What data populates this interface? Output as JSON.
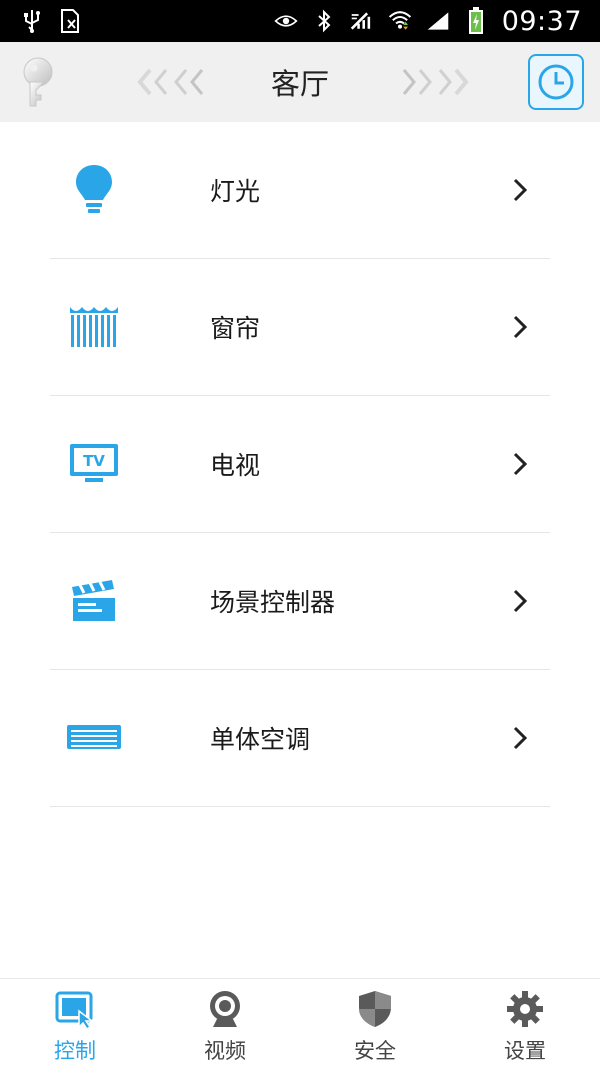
{
  "status_bar": {
    "time": "09:37"
  },
  "header": {
    "title": "客厅"
  },
  "devices": [
    {
      "label": "灯光",
      "icon": "lightbulb-icon"
    },
    {
      "label": "窗帘",
      "icon": "curtain-icon"
    },
    {
      "label": "电视",
      "icon": "tv-icon"
    },
    {
      "label": "场景控制器",
      "icon": "clapperboard-icon"
    },
    {
      "label": "单体空调",
      "icon": "air-conditioner-icon"
    }
  ],
  "tv_icon_text": "TV",
  "bottom_nav": [
    {
      "label": "控制",
      "icon": "control-icon",
      "active": true
    },
    {
      "label": "视频",
      "icon": "camera-icon",
      "active": false
    },
    {
      "label": "安全",
      "icon": "shield-icon",
      "active": false
    },
    {
      "label": "设置",
      "icon": "gear-icon",
      "active": false
    }
  ],
  "colors": {
    "accent": "#2aa6e8",
    "status_bar_bg": "#000000",
    "header_bg": "#f0f0f0",
    "text": "#1a1a1a",
    "inactive_icon": "#555555"
  }
}
